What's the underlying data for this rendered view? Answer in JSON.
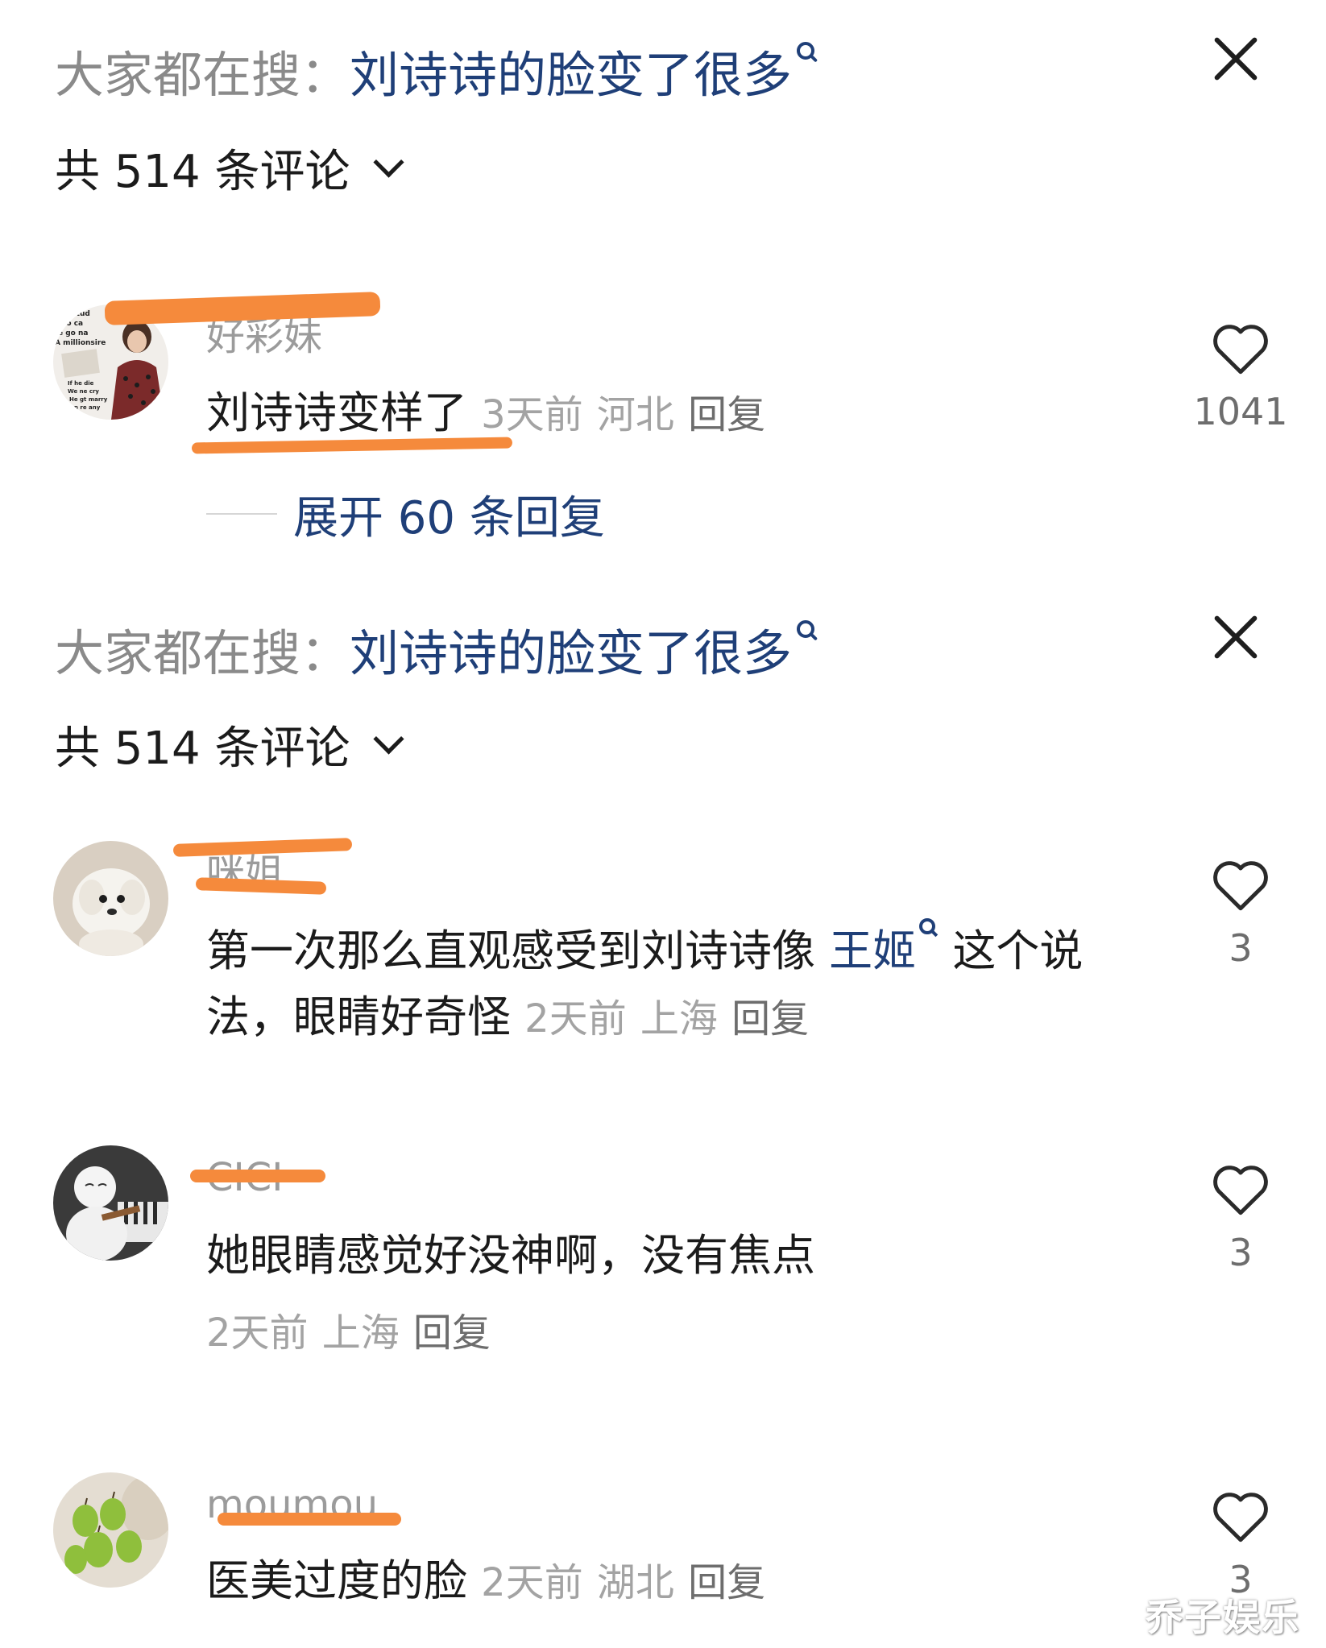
{
  "panels": [
    {
      "search": {
        "prefix": "大家都在搜：",
        "term": "刘诗诗的脸变了很多"
      },
      "comment_count_label": "共 514 条评论"
    },
    {
      "search": {
        "prefix": "大家都在搜：",
        "term": "刘诗诗的脸变了很多"
      },
      "comment_count_label": "共 514 条评论"
    }
  ],
  "comments": [
    {
      "username": "好彩妹",
      "text": "刘诗诗变样了",
      "time": "3天前",
      "location": "河北",
      "reply_label": "回复",
      "likes": "1041",
      "expand_label": "展开 60 条回复",
      "avatar_text": [
        "o stud",
        "no ca",
        "e go na",
        "A millionsire",
        "If he die",
        "We ne cry",
        "He gt marry",
        "n re any"
      ]
    },
    {
      "username": "咪姐",
      "text_before": "第一次那么直观感受到刘诗诗像",
      "mention": "王姬",
      "text_after": "这个说法，眼睛好奇怪",
      "time": "2天前",
      "location": "上海",
      "reply_label": "回复",
      "likes": "3"
    },
    {
      "username": "CICI",
      "text": "她眼睛感觉好没神啊，没有焦点",
      "time": "2天前",
      "location": "上海",
      "reply_label": "回复",
      "likes": "3"
    },
    {
      "username": "moumou",
      "text": "医美过度的脸",
      "time": "2天前",
      "location": "湖北",
      "reply_label": "回复",
      "likes": "3"
    }
  ],
  "watermark": "乔子娱乐",
  "colors": {
    "link_blue": "#1f3f78",
    "meta_gray": "#a3a3a3",
    "highlight_orange": "#f58a3c"
  },
  "icons": [
    "close-icon",
    "search-icon",
    "chevron-down-icon",
    "heart-icon"
  ]
}
